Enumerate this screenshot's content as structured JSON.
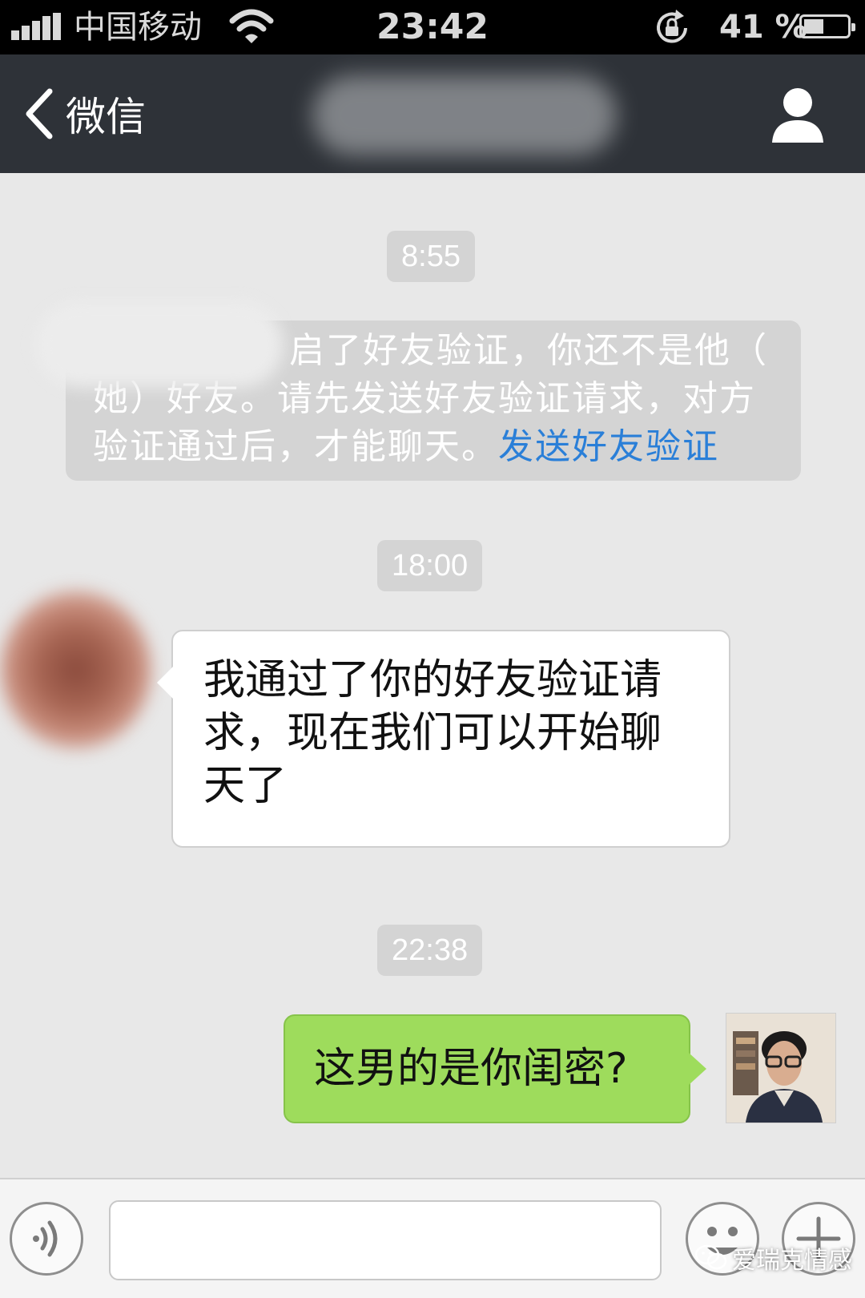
{
  "status_bar": {
    "carrier": "中国移动",
    "time": "23:42",
    "battery_percent": "41 %",
    "battery_level": 0.41,
    "icons": [
      "signal-icon",
      "wifi-icon",
      "rotation-lock-icon",
      "battery-icon"
    ]
  },
  "nav": {
    "back_label": "微信",
    "icons": [
      "back-chevron-icon",
      "contact-info-icon"
    ]
  },
  "chat": {
    "timestamps": [
      "8:55",
      "18:00",
      "22:38"
    ],
    "system_notice": {
      "lines": [
        "启了好友验证，你还不是他（",
        "她）好友。请先发送好友验证请求，对方",
        "验证通过后，才能聊天。"
      ],
      "link": "发送好友验证"
    },
    "incoming": {
      "lines": [
        "我通过了你的好友验证请",
        "求，现在我们可以开始聊",
        "天了"
      ]
    },
    "outgoing": {
      "text": "这男的是你闺密?"
    }
  },
  "input_bar": {
    "value": "",
    "icons": [
      "voice-icon",
      "emoji-icon",
      "plus-icon"
    ]
  },
  "watermark": "爱瑞克情感",
  "colors": {
    "chat_bg": "#e8e8e8",
    "nav_bg": "#2e3238",
    "outgoing_bubble": "#9edc5c",
    "link": "#2a7fd8",
    "timestamp_bg": "#d4d4d4"
  }
}
